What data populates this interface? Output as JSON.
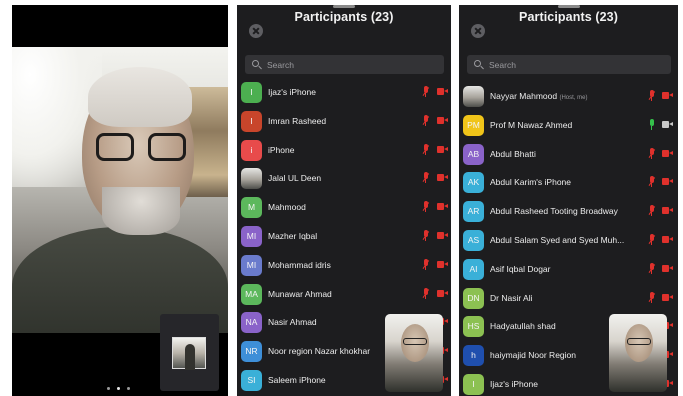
{
  "colors": {
    "panel_bg": "#1d1d1f",
    "muted_red": "#e0312c",
    "unmuted_green": "#35c04b"
  },
  "call": {
    "pager_dots": 3,
    "active_dot": 2
  },
  "panel_left": {
    "title": "Participants (23)",
    "search_placeholder": "Search",
    "participants": [
      {
        "initials": "I",
        "color": "#4caf50",
        "name": "Ijaz's iPhone",
        "mic": "muted",
        "video": "off"
      },
      {
        "initials": "I",
        "color": "#c8452b",
        "name": "Imran Rasheed",
        "mic": "muted",
        "video": "off"
      },
      {
        "initials": "i",
        "color": "#e84b4b",
        "name": "iPhone",
        "mic": "muted",
        "video": "off"
      },
      {
        "initials": "",
        "color": "photo",
        "name": "Jalal UL Deen",
        "mic": "muted",
        "video": "off"
      },
      {
        "initials": "M",
        "color": "#5cb85c",
        "name": "Mahmood",
        "mic": "muted",
        "video": "off"
      },
      {
        "initials": "MI",
        "color": "#8a63c9",
        "name": "Mazher Iqbal",
        "mic": "muted",
        "video": "off"
      },
      {
        "initials": "MI",
        "color": "#6a7bcc",
        "name": "Mohammad idris",
        "mic": "muted",
        "video": "off"
      },
      {
        "initials": "MA",
        "color": "#5cb85c",
        "name": "Munawar Ahmad",
        "mic": "muted",
        "video": "off"
      },
      {
        "initials": "NA",
        "color": "#8a63c9",
        "name": "Nasir Ahmad",
        "mic": "muted",
        "video": "off"
      },
      {
        "initials": "NR",
        "color": "#3e8fd8",
        "name": "Noor region Nazar khokhar",
        "mic": "muted",
        "video": "off"
      },
      {
        "initials": "SI",
        "color": "#3ab0d8",
        "name": "Saleem iPhone",
        "mic": "muted",
        "video": "off"
      }
    ]
  },
  "panel_right": {
    "title": "Participants (23)",
    "search_placeholder": "Search",
    "participants": [
      {
        "initials": "",
        "color": "photo",
        "name": "Nayyar Mahmood",
        "role": "(Host, me)",
        "mic": "muted",
        "video": "off"
      },
      {
        "initials": "PM",
        "color": "#f0c419",
        "name": "Prof M Nawaz Ahmed",
        "mic": "on",
        "video": "on"
      },
      {
        "initials": "AB",
        "color": "#8a63c9",
        "name": "Abdul Bhatti",
        "mic": "muted",
        "video": "off"
      },
      {
        "initials": "AK",
        "color": "#3ab0d8",
        "name": "Abdul Karim's iPhone",
        "mic": "muted",
        "video": "off"
      },
      {
        "initials": "AR",
        "color": "#3ab0d8",
        "name": "Abdul Rasheed Tooting Broadway",
        "mic": "muted",
        "video": "off"
      },
      {
        "initials": "AS",
        "color": "#3ab0d8",
        "name": "Abdul Salam Syed and Syed Muh...",
        "mic": "muted",
        "video": "off"
      },
      {
        "initials": "AI",
        "color": "#3ab0d8",
        "name": "Asif Iqbal Dogar",
        "mic": "muted",
        "video": "off"
      },
      {
        "initials": "DN",
        "color": "#8cc152",
        "name": "Dr Nasir Ali",
        "mic": "muted",
        "video": "off"
      },
      {
        "initials": "HS",
        "color": "#8cc152",
        "name": "Hadyatullah shad",
        "mic": "muted",
        "video": "off"
      },
      {
        "initials": "h",
        "color": "#1f4fae",
        "name": "haiymajid Noor Region",
        "mic": "muted",
        "video": "off"
      },
      {
        "initials": "I",
        "color": "#8cc152",
        "name": "Ijaz's iPhone",
        "mic": "muted",
        "video": "off"
      }
    ]
  }
}
